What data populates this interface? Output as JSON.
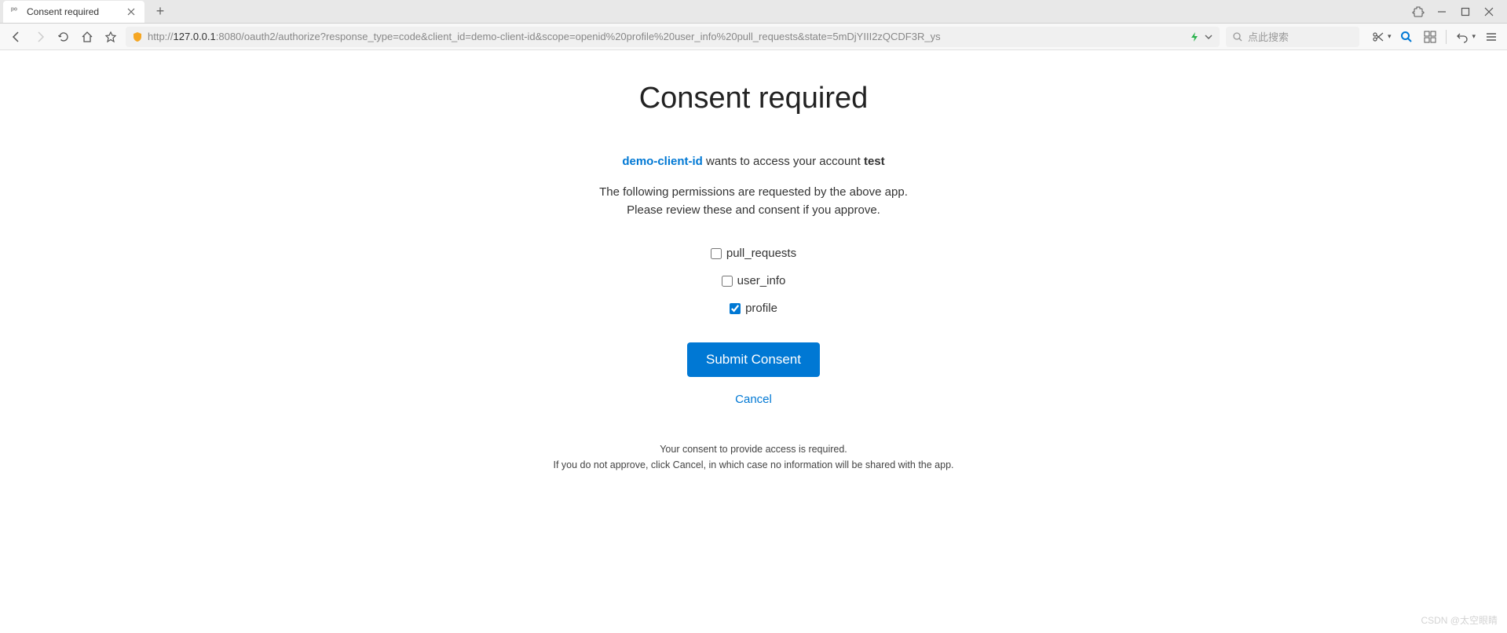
{
  "browser": {
    "tab_title": "Consent required",
    "url_prefix": "http://",
    "url_host": "127.0.0.1",
    "url_rest": ":8080/oauth2/authorize?response_type=code&client_id=demo-client-id&scope=openid%20profile%20user_info%20pull_requests&state=5mDjYIII2zQCDF3R_ys",
    "search_placeholder": "点此搜索"
  },
  "page": {
    "title": "Consent required",
    "client_id": "demo-client-id",
    "access_text": " wants to access your account ",
    "account": "test",
    "explain_line1": "The following permissions are requested by the above app.",
    "explain_line2": "Please review these and consent if you approve.",
    "scopes": [
      {
        "label": "pull_requests",
        "checked": false
      },
      {
        "label": "user_info",
        "checked": false
      },
      {
        "label": "profile",
        "checked": true
      }
    ],
    "submit_label": "Submit Consent",
    "cancel_label": "Cancel",
    "footer_line1": "Your consent to provide access is required.",
    "footer_line2": "If you do not approve, click Cancel, in which case no information will be shared with the app."
  },
  "watermark": "CSDN @太空眼睛"
}
